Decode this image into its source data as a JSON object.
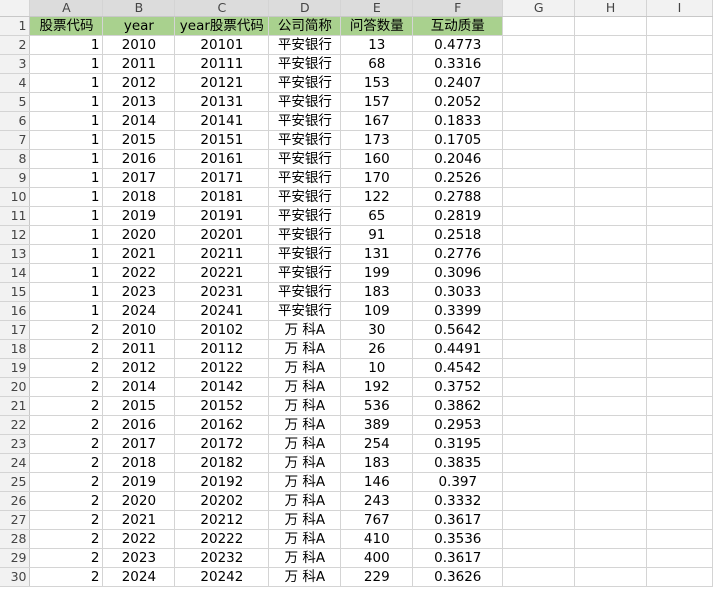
{
  "columns": [
    "A",
    "B",
    "C",
    "D",
    "E",
    "F",
    "G",
    "H",
    "I"
  ],
  "header_row": {
    "row_number": "1",
    "cells": [
      "股票代码",
      "year",
      "year股票代码",
      "公司简称",
      "问答数量",
      "互动质量"
    ]
  },
  "header_fill_color": "#a9d18e",
  "rows": [
    {
      "n": "2",
      "cells": [
        "1",
        "2010",
        "20101",
        "平安银行",
        "13",
        "0.4773"
      ]
    },
    {
      "n": "3",
      "cells": [
        "1",
        "2011",
        "20111",
        "平安银行",
        "68",
        "0.3316"
      ]
    },
    {
      "n": "4",
      "cells": [
        "1",
        "2012",
        "20121",
        "平安银行",
        "153",
        "0.2407"
      ]
    },
    {
      "n": "5",
      "cells": [
        "1",
        "2013",
        "20131",
        "平安银行",
        "157",
        "0.2052"
      ]
    },
    {
      "n": "6",
      "cells": [
        "1",
        "2014",
        "20141",
        "平安银行",
        "167",
        "0.1833"
      ]
    },
    {
      "n": "7",
      "cells": [
        "1",
        "2015",
        "20151",
        "平安银行",
        "173",
        "0.1705"
      ]
    },
    {
      "n": "8",
      "cells": [
        "1",
        "2016",
        "20161",
        "平安银行",
        "160",
        "0.2046"
      ]
    },
    {
      "n": "9",
      "cells": [
        "1",
        "2017",
        "20171",
        "平安银行",
        "170",
        "0.2526"
      ]
    },
    {
      "n": "10",
      "cells": [
        "1",
        "2018",
        "20181",
        "平安银行",
        "122",
        "0.2788"
      ]
    },
    {
      "n": "11",
      "cells": [
        "1",
        "2019",
        "20191",
        "平安银行",
        "65",
        "0.2819"
      ]
    },
    {
      "n": "12",
      "cells": [
        "1",
        "2020",
        "20201",
        "平安银行",
        "91",
        "0.2518"
      ]
    },
    {
      "n": "13",
      "cells": [
        "1",
        "2021",
        "20211",
        "平安银行",
        "131",
        "0.2776"
      ]
    },
    {
      "n": "14",
      "cells": [
        "1",
        "2022",
        "20221",
        "平安银行",
        "199",
        "0.3096"
      ]
    },
    {
      "n": "15",
      "cells": [
        "1",
        "2023",
        "20231",
        "平安银行",
        "183",
        "0.3033"
      ]
    },
    {
      "n": "16",
      "cells": [
        "1",
        "2024",
        "20241",
        "平安银行",
        "109",
        "0.3399"
      ]
    },
    {
      "n": "17",
      "cells": [
        "2",
        "2010",
        "20102",
        "万 科A",
        "30",
        "0.5642"
      ]
    },
    {
      "n": "18",
      "cells": [
        "2",
        "2011",
        "20112",
        "万 科A",
        "26",
        "0.4491"
      ]
    },
    {
      "n": "19",
      "cells": [
        "2",
        "2012",
        "20122",
        "万 科A",
        "10",
        "0.4542"
      ]
    },
    {
      "n": "20",
      "cells": [
        "2",
        "2014",
        "20142",
        "万 科A",
        "192",
        "0.3752"
      ]
    },
    {
      "n": "21",
      "cells": [
        "2",
        "2015",
        "20152",
        "万 科A",
        "536",
        "0.3862"
      ]
    },
    {
      "n": "22",
      "cells": [
        "2",
        "2016",
        "20162",
        "万 科A",
        "389",
        "0.2953"
      ]
    },
    {
      "n": "23",
      "cells": [
        "2",
        "2017",
        "20172",
        "万 科A",
        "254",
        "0.3195"
      ]
    },
    {
      "n": "24",
      "cells": [
        "2",
        "2018",
        "20182",
        "万 科A",
        "183",
        "0.3835"
      ]
    },
    {
      "n": "25",
      "cells": [
        "2",
        "2019",
        "20192",
        "万 科A",
        "146",
        "0.397"
      ]
    },
    {
      "n": "26",
      "cells": [
        "2",
        "2020",
        "20202",
        "万 科A",
        "243",
        "0.3332"
      ]
    },
    {
      "n": "27",
      "cells": [
        "2",
        "2021",
        "20212",
        "万 科A",
        "767",
        "0.3617"
      ]
    },
    {
      "n": "28",
      "cells": [
        "2",
        "2022",
        "20222",
        "万 科A",
        "410",
        "0.3536"
      ]
    },
    {
      "n": "29",
      "cells": [
        "2",
        "2023",
        "20232",
        "万 科A",
        "400",
        "0.3617"
      ]
    },
    {
      "n": "30",
      "cells": [
        "2",
        "2024",
        "20242",
        "万 科A",
        "229",
        "0.3626"
      ]
    }
  ]
}
